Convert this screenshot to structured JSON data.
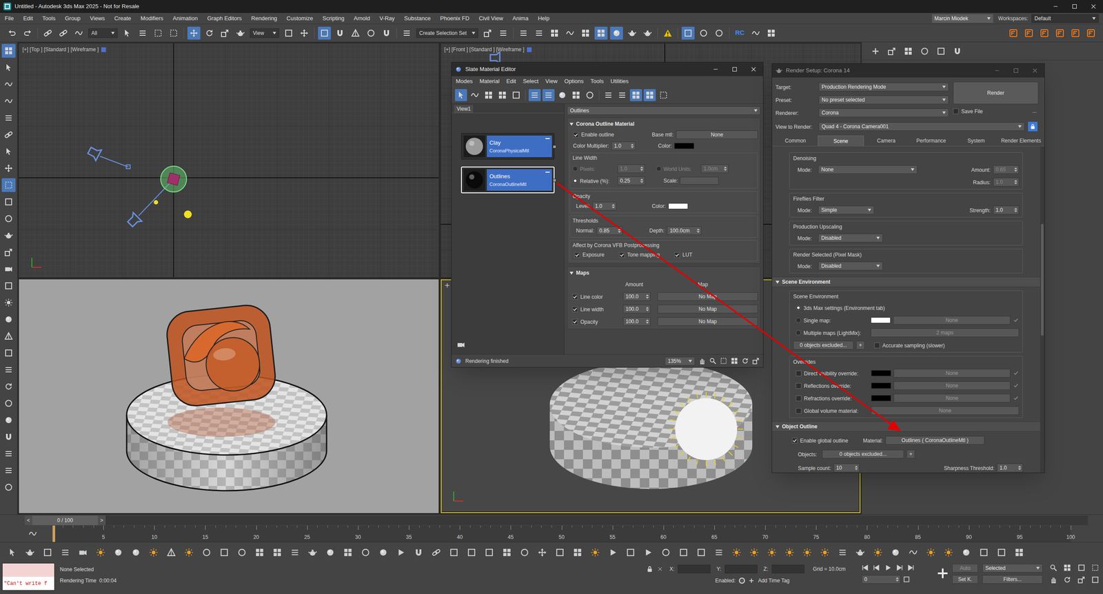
{
  "window": {
    "title": "Untitled - Autodesk 3ds Max 2025 - Not for Resale"
  },
  "menu": [
    "File",
    "Edit",
    "Tools",
    "Group",
    "Views",
    "Create",
    "Modifiers",
    "Animation",
    "Graph Editors",
    "Rendering",
    "Customize",
    "Scripting",
    "Arnold",
    "V-Ray",
    "Substance",
    "Phoenix FD",
    "Civil View",
    "Anima",
    "Help"
  ],
  "account": {
    "user": "Marcin Miodek",
    "workspaces_label": "Workspaces:",
    "workspace": "Default"
  },
  "toolbar": [
    {
      "kind": "undo",
      "active": false
    },
    {
      "kind": "redo",
      "active": false
    },
    {
      "kind": "sep"
    },
    {
      "kind": "link",
      "active": false
    },
    {
      "kind": "link",
      "active": false
    },
    {
      "kind": "wave",
      "active": false
    },
    {
      "kind": "dropdown",
      "value": "All"
    },
    {
      "kind": "cursor",
      "active": false
    },
    {
      "kind": "lines",
      "active": false
    },
    {
      "kind": "dash",
      "active": false
    },
    {
      "kind": "dash",
      "active": false
    },
    {
      "kind": "sep"
    },
    {
      "kind": "move",
      "active": true
    },
    {
      "kind": "rotate",
      "active": false
    },
    {
      "kind": "scale",
      "active": false
    },
    {
      "kind": "teapot",
      "active": false
    },
    {
      "kind": "dropdown",
      "value": "View"
    },
    {
      "kind": "box",
      "active": false
    },
    {
      "kind": "move",
      "active": false
    },
    {
      "kind": "sep"
    },
    {
      "kind": "box",
      "active": true
    },
    {
      "kind": "magnet",
      "active": false
    },
    {
      "kind": "pyramid",
      "active": false
    },
    {
      "kind": "circle",
      "active": false
    },
    {
      "kind": "magnet",
      "active": false
    },
    {
      "kind": "sep"
    },
    {
      "kind": "lines",
      "active": false
    },
    {
      "kind": "dropdown",
      "value": "Create Selection Set"
    },
    {
      "kind": "scale",
      "active": false
    },
    {
      "kind": "lines",
      "active": false
    },
    {
      "kind": "sep"
    },
    {
      "kind": "lines",
      "active": false
    },
    {
      "kind": "lines",
      "active": false
    },
    {
      "kind": "grid",
      "active": false
    },
    {
      "kind": "wave",
      "active": false
    },
    {
      "kind": "grid",
      "active": false
    },
    {
      "kind": "grid",
      "active": true
    },
    {
      "kind": "dot",
      "active": true
    },
    {
      "kind": "teapot",
      "active": false
    },
    {
      "kind": "teapot",
      "active": false
    },
    {
      "kind": "sep"
    },
    {
      "kind": "warning",
      "active": false
    },
    {
      "kind": "sep"
    },
    {
      "kind": "box",
      "active": true
    },
    {
      "kind": "circle",
      "active": false
    },
    {
      "kind": "circle",
      "active": false
    },
    {
      "kind": "sep"
    },
    {
      "kind": "badge",
      "value": "RC"
    },
    {
      "kind": "wave",
      "active": false
    },
    {
      "kind": "grid",
      "active": false
    },
    {
      "kind": "spacer"
    },
    {
      "kind": "plugin",
      "active": false
    },
    {
      "kind": "plugin",
      "active": false
    },
    {
      "kind": "plugin",
      "active": false
    },
    {
      "kind": "plugin",
      "active": false
    },
    {
      "kind": "plugin",
      "active": false
    },
    {
      "kind": "plugin",
      "active": false
    }
  ],
  "side_toolbar": [
    {
      "kind": "grid",
      "active": true
    },
    {
      "kind": "cursor",
      "active": false
    },
    {
      "kind": "wave",
      "active": false
    },
    {
      "kind": "wave",
      "active": false
    },
    {
      "kind": "lines",
      "active": false
    },
    {
      "kind": "link",
      "active": false
    },
    {
      "kind": "cursor",
      "active": false
    },
    {
      "kind": "move",
      "active": false
    },
    {
      "kind": "dash",
      "active": true
    },
    {
      "kind": "box",
      "active": false
    },
    {
      "kind": "circle",
      "active": false
    },
    {
      "kind": "teapot",
      "active": false
    },
    {
      "kind": "scale",
      "active": false
    },
    {
      "kind": "camera",
      "active": false
    },
    {
      "kind": "box",
      "active": false
    },
    {
      "kind": "sun",
      "active": false
    },
    {
      "kind": "dot",
      "active": false
    },
    {
      "kind": "pyramid",
      "active": false
    },
    {
      "kind": "box",
      "active": false
    },
    {
      "kind": "lines",
      "active": false
    },
    {
      "kind": "rotate",
      "active": false
    },
    {
      "kind": "circle",
      "active": false
    },
    {
      "kind": "dot",
      "active": false
    },
    {
      "kind": "magnet",
      "active": false
    },
    {
      "kind": "lines",
      "active": false
    },
    {
      "kind": "lines",
      "active": false
    },
    {
      "kind": "circle",
      "active": false
    }
  ],
  "viewports": [
    {
      "kind": "top",
      "label": "[+] [Top ] [Standard ] [Wireframe ]",
      "active": false
    },
    {
      "kind": "front",
      "label": "[+] [Front ] [Standard ] [Wireframe ]",
      "active": false
    },
    {
      "kind": "render",
      "active": false
    },
    {
      "kind": "shaded",
      "active": true
    }
  ],
  "slate": {
    "title": "Slate Material Editor",
    "menu": [
      "Modes",
      "Material",
      "Edit",
      "Select",
      "View",
      "Options",
      "Tools",
      "Utilities"
    ],
    "toolbar": [
      {
        "kind": "cursor",
        "active": true
      },
      {
        "kind": "wave",
        "active": false
      },
      {
        "kind": "grid",
        "active": false
      },
      {
        "kind": "grid",
        "active": false
      },
      {
        "kind": "box",
        "active": false
      },
      {
        "kind": "sep"
      },
      {
        "kind": "lines",
        "active": true
      },
      {
        "kind": "lines",
        "active": true
      },
      {
        "kind": "dot",
        "active": false
      },
      {
        "kind": "grid",
        "active": false
      },
      {
        "kind": "circle",
        "active": false
      },
      {
        "kind": "sep"
      },
      {
        "kind": "lines",
        "active": false
      },
      {
        "kind": "lines",
        "active": false
      },
      {
        "kind": "grid",
        "active": true
      },
      {
        "kind": "grid",
        "active": true
      },
      {
        "kind": "dash",
        "active": false
      }
    ],
    "view_tab": "View1",
    "nodes": [
      {
        "name": "Clay",
        "type": "CoronaPhysicalMtl",
        "selected": false,
        "preview": "#9a9a9a"
      },
      {
        "name": "Outlines",
        "type": "CoronaOutlineMtl",
        "selected": true,
        "preview": "#0a0a0a"
      }
    ],
    "material": "Outlines",
    "rollout": "Corona Outline Material",
    "enable_outline": {
      "label": "Enable outline",
      "checked": true
    },
    "base_mtl": {
      "label": "Base mtl:",
      "value": "None"
    },
    "color_multiplier": {
      "label": "Color Multiplier:",
      "value": "1.0"
    },
    "line_color": {
      "label": "Color:",
      "color": "#000000"
    },
    "line_width": {
      "title": "Line Width",
      "options": [
        {
          "label": "Pixels:",
          "value": "1.0",
          "selected": false,
          "disabled": true
        },
        {
          "label": "World Units:",
          "value": "1.0cm",
          "selected": false,
          "disabled": true
        },
        {
          "label": "Relative (%):",
          "value": "0.25",
          "selected": true,
          "disabled": false
        }
      ],
      "scale_label": "Scale:"
    },
    "opacity": {
      "title": "Opacity",
      "level_label": "Level:",
      "level": "1.0",
      "color_label": "Color:",
      "color": "#ffffff"
    },
    "thresholds": {
      "title": "Thresholds",
      "normal_label": "Normal:",
      "normal": "0.85",
      "depth_label": "Depth:",
      "depth": "100.0cm"
    },
    "postprocessing": {
      "title": "Affect by Corona VFB Postprocessing",
      "items": [
        {
          "label": "Exposure",
          "checked": true
        },
        {
          "label": "Tone mapping",
          "checked": true
        },
        {
          "label": "LUT",
          "checked": true
        }
      ]
    },
    "maps": {
      "title": "Maps",
      "columns": [
        "Amount",
        "Map"
      ],
      "rows": [
        {
          "label": "Line color",
          "checked": true,
          "amount": "100.0",
          "map": "No Map"
        },
        {
          "label": "Line width",
          "checked": true,
          "amount": "100.0",
          "map": "No Map"
        },
        {
          "label": "Opacity",
          "checked": true,
          "amount": "100.0",
          "map": "No Map"
        }
      ]
    },
    "status": "Rendering finished",
    "zoom": "135%"
  },
  "render_setup": {
    "title": "Render Setup: Corona 14",
    "rows": [
      {
        "label": "Target:",
        "value": "Production Rendering Mode"
      },
      {
        "label": "Preset:",
        "value": "No preset selected"
      },
      {
        "label": "Renderer:",
        "value": "Corona"
      }
    ],
    "save_file": {
      "label": "Save File",
      "checked": false
    },
    "more": "...",
    "render_button": "Render",
    "view_to_render": {
      "label": "View to Render:",
      "value": "Quad 4 - Corona Camera001"
    },
    "tabs": [
      {
        "label": "Common",
        "selected": false
      },
      {
        "label": "Scene",
        "selected": true
      },
      {
        "label": "Camera",
        "selected": false
      },
      {
        "label": "Performance",
        "selected": false
      },
      {
        "label": "System",
        "selected": false
      },
      {
        "label": "Render Elements",
        "selected": false
      }
    ],
    "denoising": {
      "title": "Denoising",
      "mode_label": "Mode:",
      "mode": "None",
      "amount_label": "Amount:",
      "amount": "0.65",
      "radius_label": "Radius:",
      "radius": "1.0",
      "disabled": true
    },
    "fireflies": {
      "title": "Fireflies Filter",
      "mode_label": "Mode:",
      "mode": "Simple",
      "strength_label": "Strength:",
      "strength": "1.0"
    },
    "upscaling": {
      "title": "Production Upscaling",
      "mode_label": "Mode:",
      "mode": "Disabled"
    },
    "pixel_mask": {
      "title": "Render Selected (Pixel Mask)",
      "mode_label": "Mode:",
      "mode": "Disabled"
    },
    "scene_env": {
      "rollout": "Scene Environment",
      "label": "Scene Environment",
      "options": [
        {
          "label": "3ds Max settings (Environment tab)",
          "selected": true
        },
        {
          "label": "Single map:",
          "selected": false,
          "map": "None",
          "color": "#ffffff"
        },
        {
          "label": "Multiple maps (LightMix):",
          "selected": false,
          "map": "2 maps"
        }
      ],
      "excluded": "0 objects excluded...",
      "add": "+",
      "accurate": {
        "label": "Accurate sampling (slower)",
        "checked": false
      }
    },
    "overrides": {
      "title": "Overrides",
      "items": [
        {
          "label": "Direct visibility override:",
          "checked": false,
          "color": "#000000",
          "map": "None"
        },
        {
          "label": "Reflections override:",
          "checked": false,
          "color": "#000000",
          "map": "None"
        },
        {
          "label": "Refractions override:",
          "checked": false,
          "color": "#000000",
          "map": "None"
        }
      ],
      "volume": {
        "label": "Global volume material:",
        "checked": false,
        "value": "None"
      }
    },
    "outline": {
      "rollout": "Object Outline",
      "enable": {
        "label": "Enable global outline",
        "checked": true
      },
      "material_label": "Material:",
      "material": "Outlines ( CoronaOutlineMtl )",
      "objects_label": "Objects:",
      "objects": "0 objects excluded...",
      "add": "+",
      "sample_label": "Sample count:",
      "sample": "10",
      "sharpness_label": "Sharpness Threshold:",
      "sharpness": "1.0"
    }
  },
  "timeline": {
    "prev": "<",
    "frame": "0 / 100",
    "next": ">",
    "level": 0,
    "ticks": [
      "5",
      "10",
      "15",
      "20",
      "25",
      "30",
      "35",
      "40",
      "45",
      "50",
      "55",
      "60",
      "65",
      "70",
      "75",
      "80",
      "85",
      "90",
      "95",
      "100"
    ]
  },
  "status": {
    "listener": "\"Can't write f",
    "selection": "None Selected",
    "render_time": "Rendering Time  0:00:04",
    "x_label": "X:",
    "y_label": "Y:",
    "z_label": "Z:",
    "grid": "Grid = 10.0cm",
    "enabled_label": "Enabled:",
    "time_tag": "Add Time Tag",
    "frame": "0",
    "auto": "Auto",
    "key_mode": "Selected",
    "set_key": "Set K.",
    "filters": "Filters..."
  }
}
